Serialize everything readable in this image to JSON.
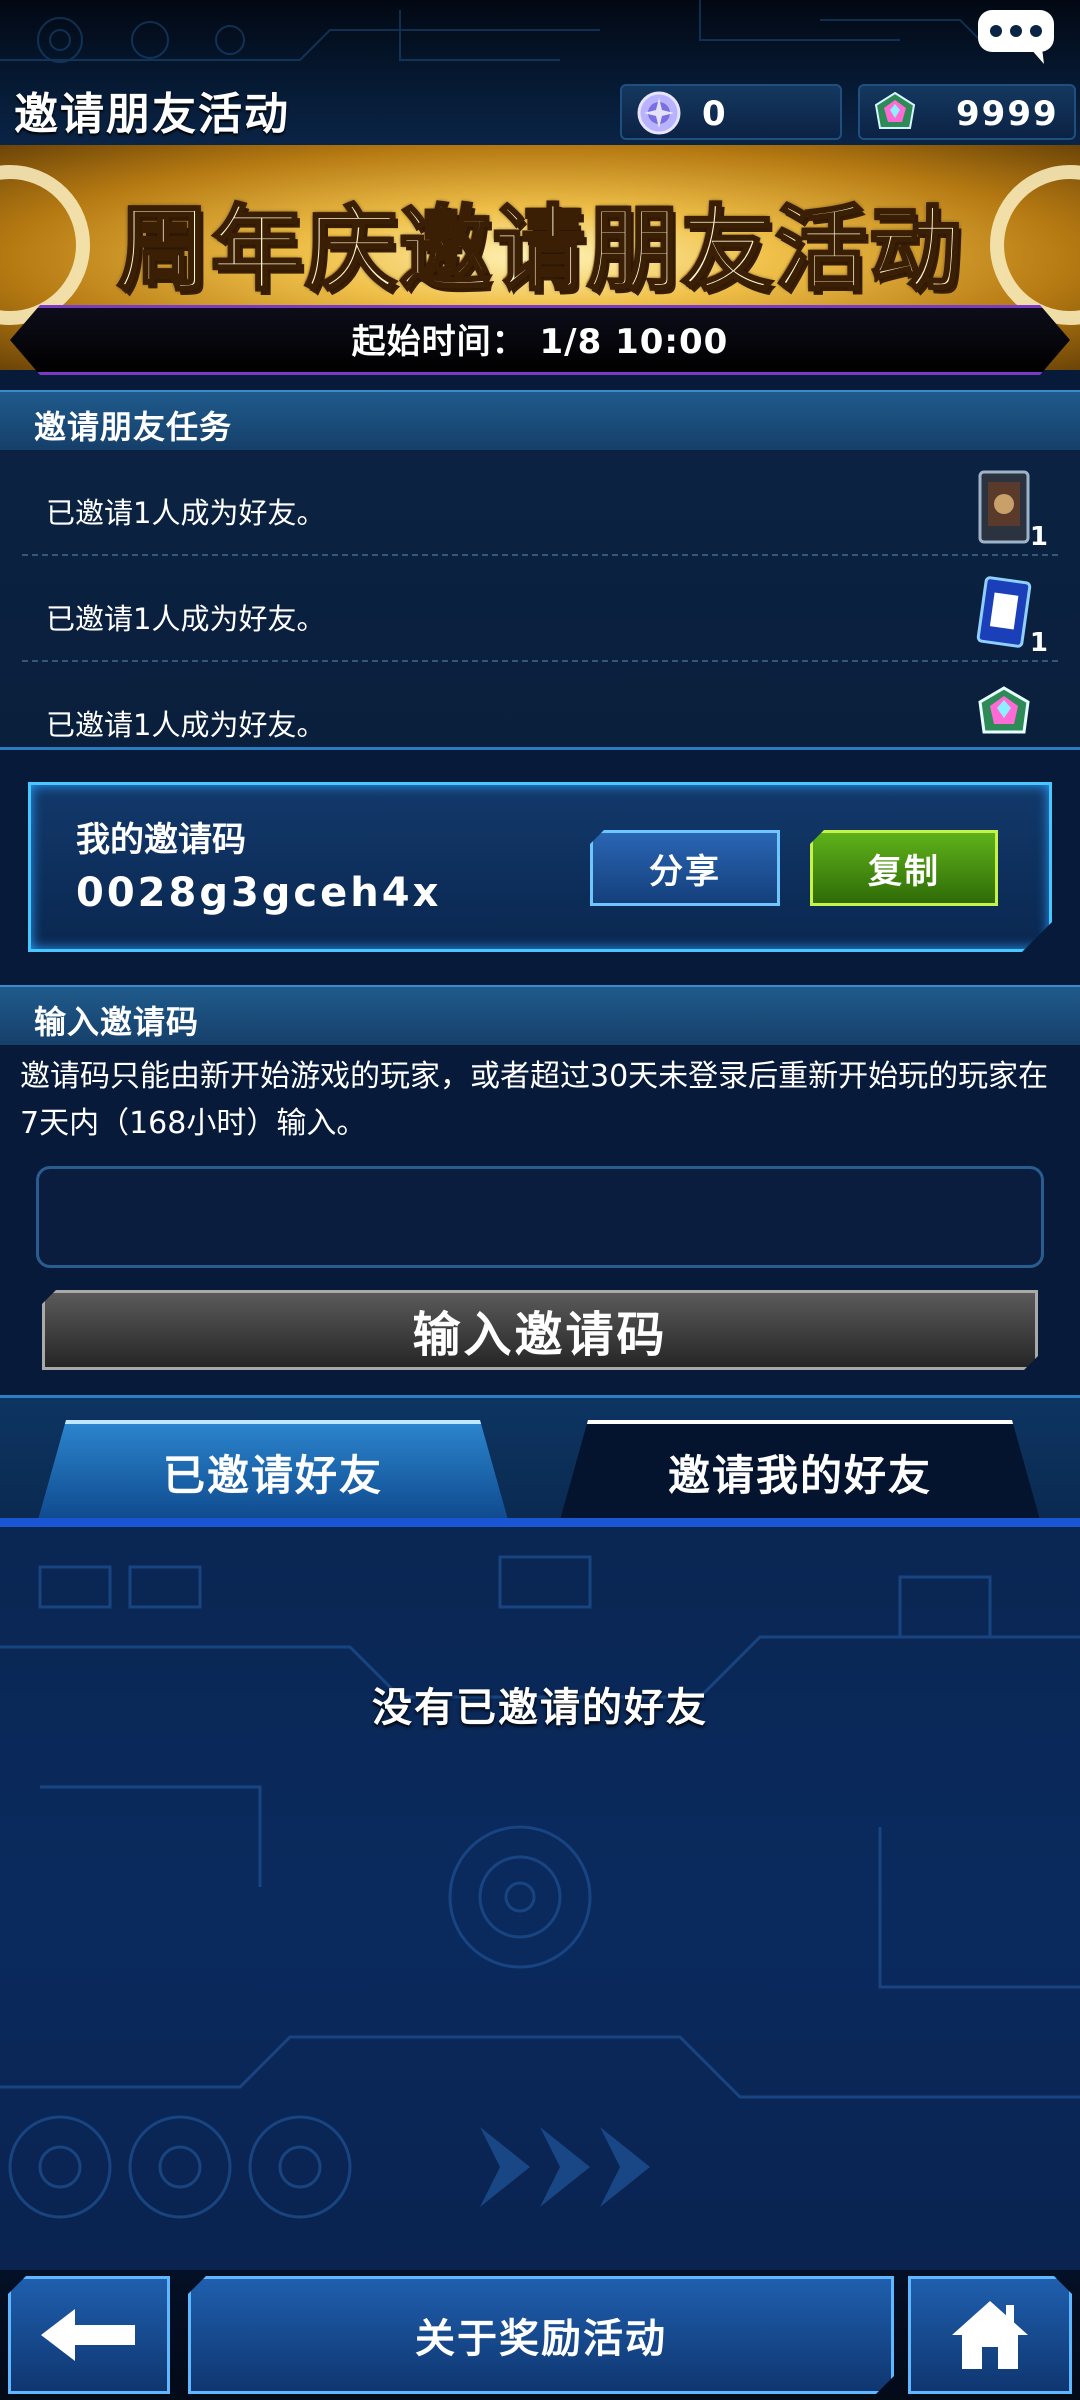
{
  "header": {
    "title": "邀请朋友活动",
    "currency_orb": "0",
    "currency_gem": "9999",
    "chat_icon": "chat-bubble-icon"
  },
  "banner": {
    "title": "周年庆邀请朋友活动",
    "start_time": "起始时间： 1/8 10:00"
  },
  "missions": {
    "heading": "邀请朋友任务",
    "items": [
      {
        "text": "已邀请1人成为好友。",
        "reward_icon": "card-pack-icon",
        "qty": "1"
      },
      {
        "text": "已邀请1人成为好友。",
        "reward_icon": "card-ticket-icon",
        "qty": "1"
      },
      {
        "text": "已邀请1人成为好友。",
        "reward_icon": "gem-icon",
        "qty": ""
      }
    ]
  },
  "invite_code": {
    "label": "我的邀请码",
    "value": "0028g3gceh4x",
    "share_label": "分享",
    "copy_label": "复制"
  },
  "input_code": {
    "heading": "输入邀请码",
    "note": "邀请码只能由新开始游戏的玩家，或者超过30天未登录后重新开始玩的玩家在7天内（168小时）输入。",
    "input_value": "",
    "button_label": "输入邀请码"
  },
  "friends": {
    "tabs": [
      "已邀请好友",
      "邀请我的好友"
    ],
    "empty_message": "没有已邀请的好友"
  },
  "footer": {
    "back_icon": "back-arrow-icon",
    "reward_label": "关于奖励活动",
    "home_icon": "home-icon"
  },
  "colors": {
    "accent_blue": "#49c7ff",
    "copy_green": "#5fb21a",
    "banner_gold": "#f0c14a",
    "tab_underline": "#1a55d4"
  }
}
